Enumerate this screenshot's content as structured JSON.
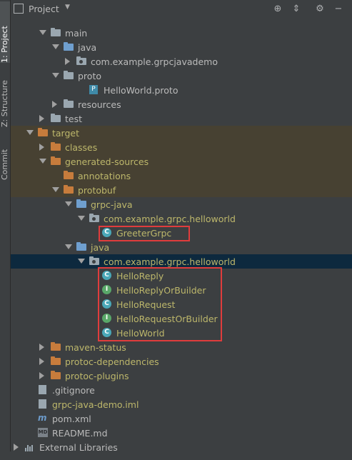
{
  "left_strip": {
    "tabs": [
      "1: Project",
      "Z: Structure",
      "Commit"
    ]
  },
  "header": {
    "title": "Project",
    "icons": [
      "target-icon",
      "collapse-icon",
      "minimize-icon",
      "gear-icon",
      "hide-icon"
    ]
  },
  "tree": {
    "rows": [
      {
        "label": "main",
        "icon": "folder-gray",
        "arrow": "down"
      },
      {
        "label": "java",
        "icon": "folder-blue",
        "arrow": "down"
      },
      {
        "label": "com.example.grpcjavademo",
        "icon": "package",
        "arrow": "right"
      },
      {
        "label": "proto",
        "icon": "folder-gray",
        "arrow": "down"
      },
      {
        "label": "HelloWorld.proto",
        "icon": "proto-file",
        "arrow": "none"
      },
      {
        "label": "resources",
        "icon": "folder-gray",
        "arrow": "right"
      },
      {
        "label": "test",
        "icon": "folder-gray",
        "arrow": "right"
      },
      {
        "label": "target",
        "icon": "folder-orange",
        "arrow": "down"
      },
      {
        "label": "classes",
        "icon": "folder-orange",
        "arrow": "right"
      },
      {
        "label": "generated-sources",
        "icon": "folder-orange",
        "arrow": "down"
      },
      {
        "label": "annotations",
        "icon": "folder-orange",
        "arrow": "none"
      },
      {
        "label": "protobuf",
        "icon": "folder-orange",
        "arrow": "down"
      },
      {
        "label": "grpc-java",
        "icon": "folder-blue-gen",
        "arrow": "down"
      },
      {
        "label": "com.example.grpc.helloworld",
        "icon": "package",
        "arrow": "down"
      },
      {
        "label": "GreeterGrpc",
        "icon": "class",
        "arrow": "none"
      },
      {
        "label": "java",
        "icon": "folder-blue-gen",
        "arrow": "down"
      },
      {
        "label": "com.example.grpc.helloworld",
        "icon": "package",
        "arrow": "down"
      },
      {
        "label": "HelloReply",
        "icon": "class",
        "arrow": "none"
      },
      {
        "label": "HelloReplyOrBuilder",
        "icon": "interface",
        "arrow": "none"
      },
      {
        "label": "HelloRequest",
        "icon": "class",
        "arrow": "none"
      },
      {
        "label": "HelloRequestOrBuilder",
        "icon": "interface",
        "arrow": "none"
      },
      {
        "label": "HelloWorld",
        "icon": "class",
        "arrow": "none"
      },
      {
        "label": "maven-status",
        "icon": "folder-orange",
        "arrow": "right"
      },
      {
        "label": "protoc-dependencies",
        "icon": "folder-orange",
        "arrow": "right"
      },
      {
        "label": "protoc-plugins",
        "icon": "folder-orange",
        "arrow": "right"
      },
      {
        "label": ".gitignore",
        "icon": "file",
        "arrow": "none"
      },
      {
        "label": "grpc-java-demo.iml",
        "icon": "file",
        "arrow": "none"
      },
      {
        "label": "pom.xml",
        "icon": "maven",
        "arrow": "none"
      },
      {
        "label": "README.md",
        "icon": "markdown",
        "arrow": "none"
      },
      {
        "label": "External Libraries",
        "icon": "libraries",
        "arrow": "right"
      }
    ]
  },
  "colors": {
    "background": "#3c3f41",
    "selected_row": "#0d293e",
    "excluded_row": "#474132",
    "annotation_box": "#e03c3c"
  }
}
